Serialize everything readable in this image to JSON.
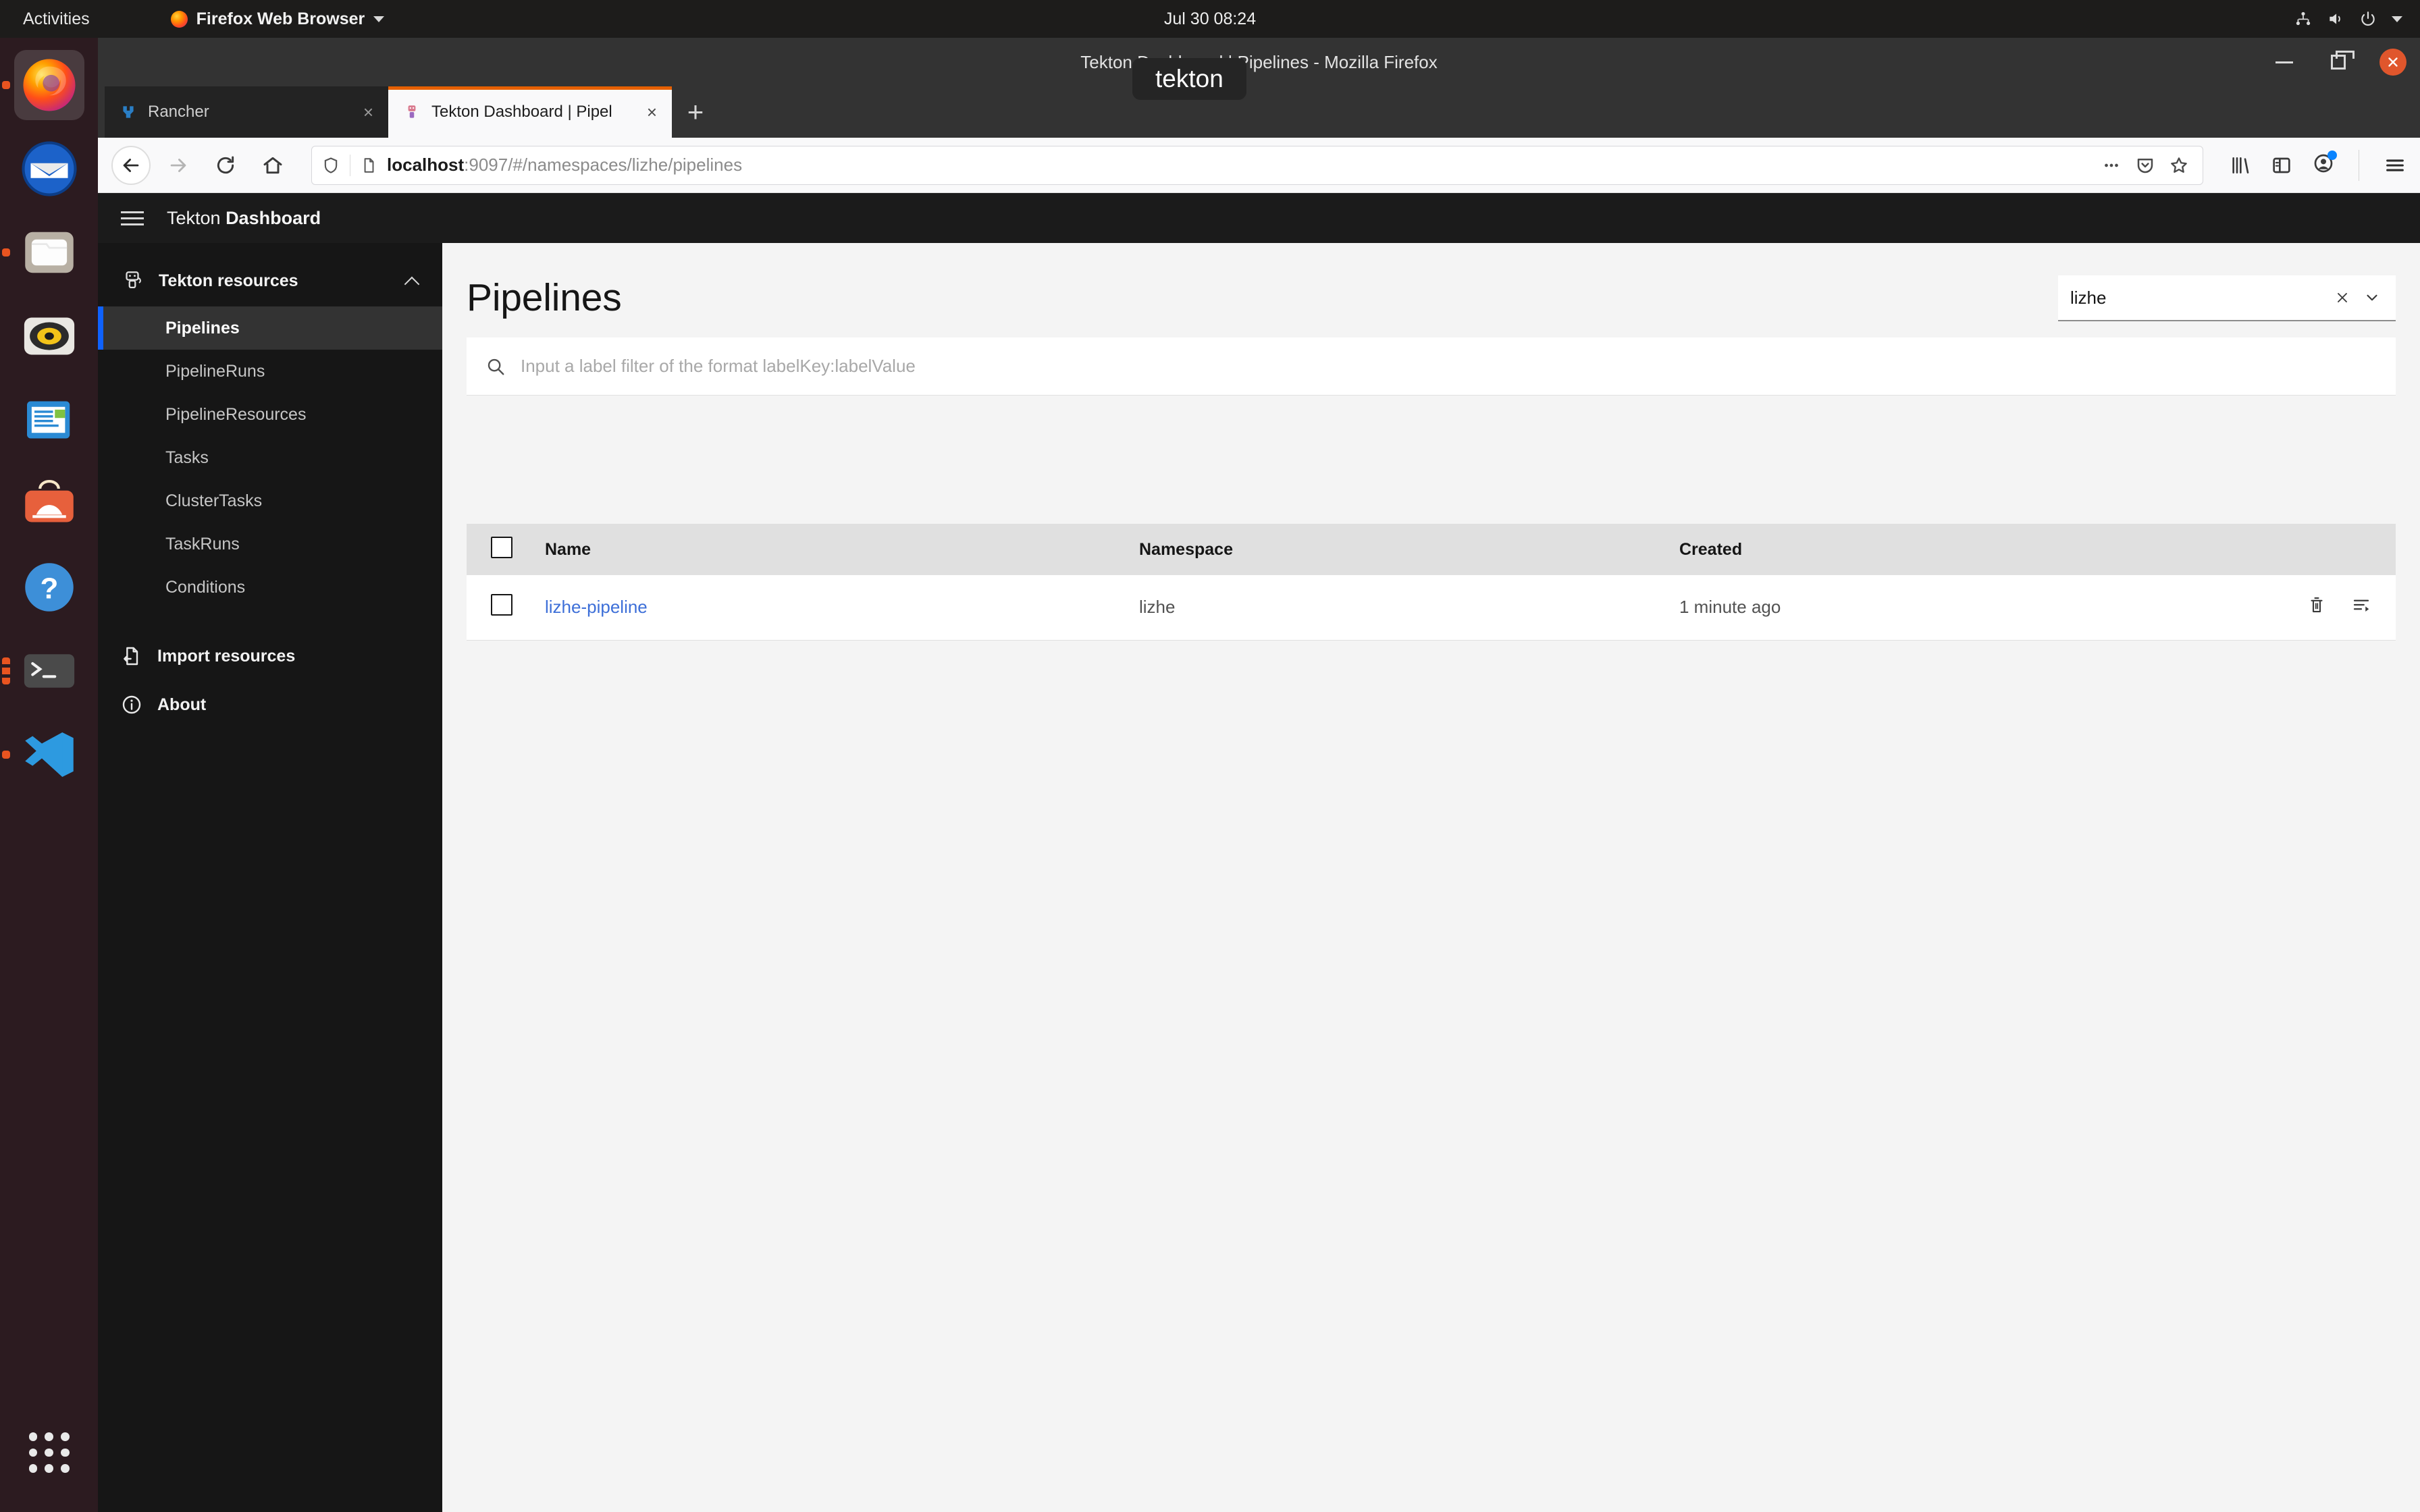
{
  "desktop": {
    "activities": "Activities",
    "app_menu": "Firefox Web Browser",
    "clock": "Jul 30  08:24",
    "indicators": [
      "network-icon",
      "volume-icon",
      "power-icon",
      "caret-down-icon"
    ]
  },
  "dock": {
    "items": [
      {
        "name": "firefox",
        "label": "Firefox",
        "running": true,
        "active": true
      },
      {
        "name": "thunderbird",
        "label": "Thunderbird",
        "running": false,
        "active": false
      },
      {
        "name": "files",
        "label": "Files",
        "running": true,
        "active": false
      },
      {
        "name": "rhythmbox",
        "label": "Rhythmbox",
        "running": false,
        "active": false
      },
      {
        "name": "libreoffice-writer",
        "label": "LibreOffice Writer",
        "running": false,
        "active": false
      },
      {
        "name": "ubuntu-software",
        "label": "Ubuntu Software",
        "running": false,
        "active": false
      },
      {
        "name": "help",
        "label": "Help",
        "running": false,
        "active": false
      },
      {
        "name": "terminal",
        "label": "Terminal",
        "running": true,
        "active": false
      },
      {
        "name": "vscode",
        "label": "Visual Studio Code",
        "running": true,
        "active": false
      }
    ],
    "show_apps_label": "Show Applications"
  },
  "browser": {
    "window_title": "Tekton Dashboard | Pipelines - Mozilla Firefox",
    "tooltip": "tekton",
    "tabs": [
      {
        "title": "Rancher",
        "active": false,
        "close_label": "×",
        "favicon": "rancher-icon"
      },
      {
        "title": "Tekton Dashboard | Pipel",
        "active": true,
        "close_label": "×",
        "favicon": "tekton-icon"
      }
    ],
    "new_tab_label": "+",
    "url": {
      "host": "localhost",
      "rest": ":9097/#/namespaces/lizhe/pipelines"
    },
    "nav": {
      "back": "back-icon",
      "forward": "forward-icon",
      "reload": "reload-icon",
      "home": "home-icon"
    },
    "url_actions": [
      "page-actions-icon",
      "pocket-icon",
      "bookmark-star-icon"
    ],
    "toolbar_right": [
      "library-icon",
      "sidebar-icon",
      "account-icon",
      "app-menu-icon"
    ],
    "window_controls": {
      "minimize": "—",
      "maximize": "□",
      "close": "×"
    }
  },
  "app": {
    "header": {
      "brand_light": "Tekton ",
      "brand_bold": "Dashboard",
      "menu_icon": "hamburger-icon"
    },
    "sidebar": {
      "section_title": "Tekton resources",
      "section_icon": "tekton-logo-icon",
      "collapse_icon": "chevron-up-icon",
      "items": [
        {
          "label": "Pipelines",
          "active": true
        },
        {
          "label": "PipelineRuns",
          "active": false
        },
        {
          "label": "PipelineResources",
          "active": false
        },
        {
          "label": "Tasks",
          "active": false
        },
        {
          "label": "ClusterTasks",
          "active": false
        },
        {
          "label": "TaskRuns",
          "active": false
        },
        {
          "label": "Conditions",
          "active": false
        }
      ],
      "links": [
        {
          "label": "Import resources",
          "icon": "import-icon"
        },
        {
          "label": "About",
          "icon": "info-icon"
        }
      ]
    },
    "main": {
      "page_title": "Pipelines",
      "namespace_select": {
        "value": "lizhe",
        "clear_icon": "close-icon",
        "expand_icon": "chevron-down-icon"
      },
      "label_filter": {
        "value": "",
        "placeholder": "Input a label filter of the format labelKey:labelValue",
        "search_icon": "search-icon"
      },
      "table": {
        "select_all_label": "select-all-checkbox",
        "columns": [
          "Name",
          "Namespace",
          "Created"
        ],
        "rows": [
          {
            "name": "lizhe-pipeline",
            "namespace": "lizhe",
            "created": "1 minute ago",
            "actions": [
              "delete-icon",
              "create-pipelinerun-icon"
            ]
          }
        ]
      }
    }
  },
  "colors": {
    "accent_blue": "#0f62fe",
    "link_blue": "#3d6fd8",
    "firefox_orange": "#e66000",
    "ubuntu_orange": "#e95420",
    "sidebar_bg": "#161616",
    "page_bg": "#f4f4f4"
  }
}
